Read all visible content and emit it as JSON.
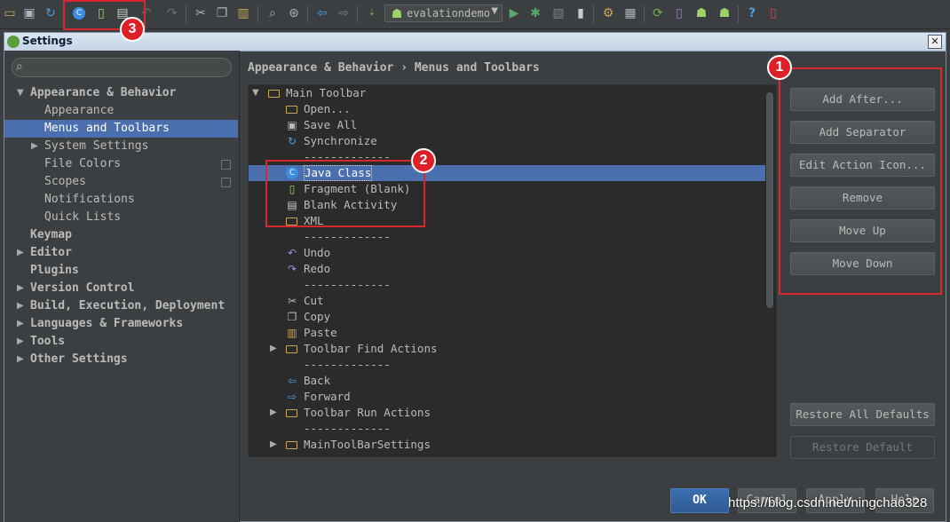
{
  "ide_toolbar": {
    "icons": [
      "open-folder-icon",
      "save-all-icon",
      "synchronize-icon",
      "java-class-icon",
      "fragment-icon",
      "blank-activity-icon",
      "undo-icon",
      "redo-icon",
      "cut-icon",
      "copy-icon",
      "paste-icon",
      "find-icon",
      "replace-icon",
      "back-icon",
      "forward-icon",
      "make-project-icon",
      "android-module-icon",
      "run-icon",
      "debug-icon",
      "attach-debugger-icon",
      "device-icon",
      "settings-icon",
      "project-structure-icon",
      "sync-gradle-icon",
      "avd-manager-icon",
      "android-icon",
      "sdk-manager-icon",
      "help-icon",
      "device-monitor-icon"
    ],
    "run_config": "evalationdemo"
  },
  "dialog": {
    "title": "Settings",
    "close_glyph": "✕",
    "search_placeholder": ""
  },
  "nav": {
    "items": [
      {
        "label": "Appearance & Behavior",
        "level": 0,
        "expanded": true,
        "bold": true
      },
      {
        "label": "Appearance",
        "level": 1
      },
      {
        "label": "Menus and Toolbars",
        "level": 1,
        "selected": true
      },
      {
        "label": "System Settings",
        "level": 1,
        "expandable": true
      },
      {
        "label": "File Colors",
        "level": 1,
        "project_icon": true
      },
      {
        "label": "Scopes",
        "level": 1,
        "project_icon": true
      },
      {
        "label": "Notifications",
        "level": 1
      },
      {
        "label": "Quick Lists",
        "level": 1
      },
      {
        "label": "Keymap",
        "level": 0,
        "bold": true
      },
      {
        "label": "Editor",
        "level": 0,
        "expandable": true,
        "bold": true
      },
      {
        "label": "Plugins",
        "level": 0,
        "bold": true
      },
      {
        "label": "Version Control",
        "level": 0,
        "expandable": true,
        "bold": true
      },
      {
        "label": "Build, Execution, Deployment",
        "level": 0,
        "expandable": true,
        "bold": true
      },
      {
        "label": "Languages & Frameworks",
        "level": 0,
        "expandable": true,
        "bold": true
      },
      {
        "label": "Tools",
        "level": 0,
        "expandable": true,
        "bold": true
      },
      {
        "label": "Other Settings",
        "level": 0,
        "expandable": true,
        "bold": true
      }
    ]
  },
  "breadcrumb": {
    "parent": "Appearance & Behavior",
    "separator": "›",
    "current": "Menus and Toolbars"
  },
  "tree": {
    "rows": [
      {
        "label": "Main Toolbar",
        "icon": "folder",
        "level": 0,
        "expanded": true
      },
      {
        "label": "Open...",
        "icon": "folder",
        "level": 1
      },
      {
        "label": "Save All",
        "icon": "save",
        "level": 1
      },
      {
        "label": "Synchronize",
        "icon": "sync",
        "level": 1
      },
      {
        "label": "-------------",
        "icon": "",
        "level": 1
      },
      {
        "label": "Java Class",
        "icon": "class",
        "level": 1,
        "selected": true
      },
      {
        "label": "Fragment (Blank)",
        "icon": "fragment",
        "level": 1
      },
      {
        "label": "Blank Activity",
        "icon": "activity",
        "level": 1
      },
      {
        "label": "XML",
        "icon": "folder",
        "level": 1
      },
      {
        "label": "-------------",
        "icon": "",
        "level": 1
      },
      {
        "label": "Undo",
        "icon": "undo",
        "level": 1
      },
      {
        "label": "Redo",
        "icon": "redo",
        "level": 1
      },
      {
        "label": "-------------",
        "icon": "",
        "level": 1
      },
      {
        "label": "Cut",
        "icon": "cut",
        "level": 1
      },
      {
        "label": "Copy",
        "icon": "copy",
        "level": 1
      },
      {
        "label": "Paste",
        "icon": "paste",
        "level": 1
      },
      {
        "label": "Toolbar Find Actions",
        "icon": "folder",
        "level": 1,
        "expandable": true
      },
      {
        "label": "-------------",
        "icon": "",
        "level": 1
      },
      {
        "label": "Back",
        "icon": "back",
        "level": 1
      },
      {
        "label": "Forward",
        "icon": "forward",
        "level": 1
      },
      {
        "label": "Toolbar Run Actions",
        "icon": "folder",
        "level": 1,
        "expandable": true
      },
      {
        "label": "-------------",
        "icon": "",
        "level": 1
      },
      {
        "label": "MainToolBarSettings",
        "icon": "folder",
        "level": 1,
        "expandable": true
      }
    ]
  },
  "actions": {
    "add_after": "Add After...",
    "add_separator": "Add Separator",
    "edit_action_icon": "Edit Action Icon...",
    "remove": "Remove",
    "move_up": "Move Up",
    "move_down": "Move Down",
    "restore_all_defaults": "Restore All Defaults",
    "restore_default": "Restore Default"
  },
  "footer": {
    "ok": "OK",
    "cancel": "Cancel",
    "apply": "Apply",
    "help": "Help"
  },
  "annotations": {
    "badge1": "1",
    "badge2": "2",
    "badge3": "3"
  },
  "watermark": "https://blog.csdn.net/ningchao328",
  "colors": {
    "accent": "#4b6eaf",
    "annotation_red": "#d8272e",
    "background": "#3c3f41",
    "tree_background": "#2b2b2b"
  }
}
